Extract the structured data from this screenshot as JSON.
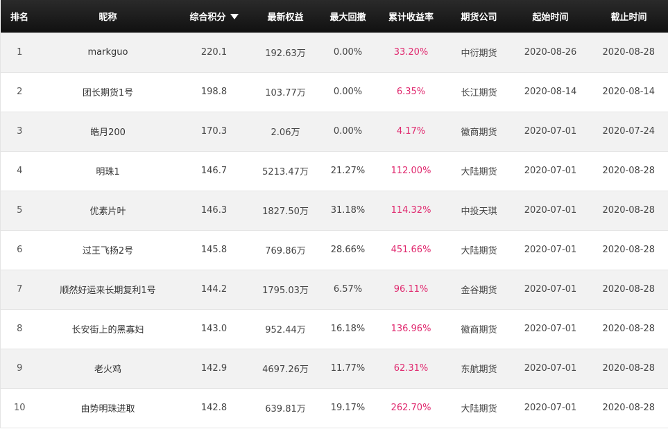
{
  "table": {
    "headers": {
      "rank": "排名",
      "nickname": "昵称",
      "score": "综合积分",
      "equity": "最新权益",
      "drawdown": "最大回撤",
      "return": "累计收益率",
      "company": "期货公司",
      "start": "起始时间",
      "end": "截止时间"
    },
    "sort": {
      "column": "score",
      "direction": "desc",
      "icon": "triangle-down-icon"
    },
    "rows": [
      {
        "rank": "1",
        "nickname": "markguo",
        "score": "220.1",
        "equity": "192.63万",
        "drawdown": "0.00%",
        "return": "33.20%",
        "company": "中衍期货",
        "start": "2020-08-26",
        "end": "2020-08-28"
      },
      {
        "rank": "2",
        "nickname": "团长期货1号",
        "score": "198.8",
        "equity": "103.77万",
        "drawdown": "0.00%",
        "return": "6.35%",
        "company": "长江期货",
        "start": "2020-08-14",
        "end": "2020-08-14"
      },
      {
        "rank": "3",
        "nickname": "皓月200",
        "score": "170.3",
        "equity": "2.06万",
        "drawdown": "0.00%",
        "return": "4.17%",
        "company": "徽商期货",
        "start": "2020-07-01",
        "end": "2020-07-24"
      },
      {
        "rank": "4",
        "nickname": "明珠1",
        "score": "146.7",
        "equity": "5213.47万",
        "drawdown": "21.27%",
        "return": "112.00%",
        "company": "大陆期货",
        "start": "2020-07-01",
        "end": "2020-08-28"
      },
      {
        "rank": "5",
        "nickname": "优素片叶",
        "score": "146.3",
        "equity": "1827.50万",
        "drawdown": "31.18%",
        "return": "114.32%",
        "company": "中投天琪",
        "start": "2020-07-01",
        "end": "2020-08-28"
      },
      {
        "rank": "6",
        "nickname": "过王飞扬2号",
        "score": "145.8",
        "equity": "769.86万",
        "drawdown": "28.66%",
        "return": "451.66%",
        "company": "大陆期货",
        "start": "2020-07-01",
        "end": "2020-08-28"
      },
      {
        "rank": "7",
        "nickname": "顺然好运来长期复利1号",
        "score": "144.2",
        "equity": "1795.03万",
        "drawdown": "6.57%",
        "return": "96.11%",
        "company": "金谷期货",
        "start": "2020-07-01",
        "end": "2020-08-28"
      },
      {
        "rank": "8",
        "nickname": "长安街上的黑寡妇",
        "score": "143.0",
        "equity": "952.44万",
        "drawdown": "16.18%",
        "return": "136.96%",
        "company": "徽商期货",
        "start": "2020-07-01",
        "end": "2020-08-28"
      },
      {
        "rank": "9",
        "nickname": "老火鸡",
        "score": "142.9",
        "equity": "4697.26万",
        "drawdown": "11.77%",
        "return": "62.31%",
        "company": "东航期货",
        "start": "2020-07-01",
        "end": "2020-08-28"
      },
      {
        "rank": "10",
        "nickname": "由势明珠进取",
        "score": "142.8",
        "equity": "639.81万",
        "drawdown": "19.17%",
        "return": "262.70%",
        "company": "大陆期货",
        "start": "2020-07-01",
        "end": "2020-08-28"
      }
    ]
  },
  "colors": {
    "header_bg": "#1a1a1a",
    "row_alt_bg": "#f2f2f2",
    "return_text": "#e0286e"
  }
}
